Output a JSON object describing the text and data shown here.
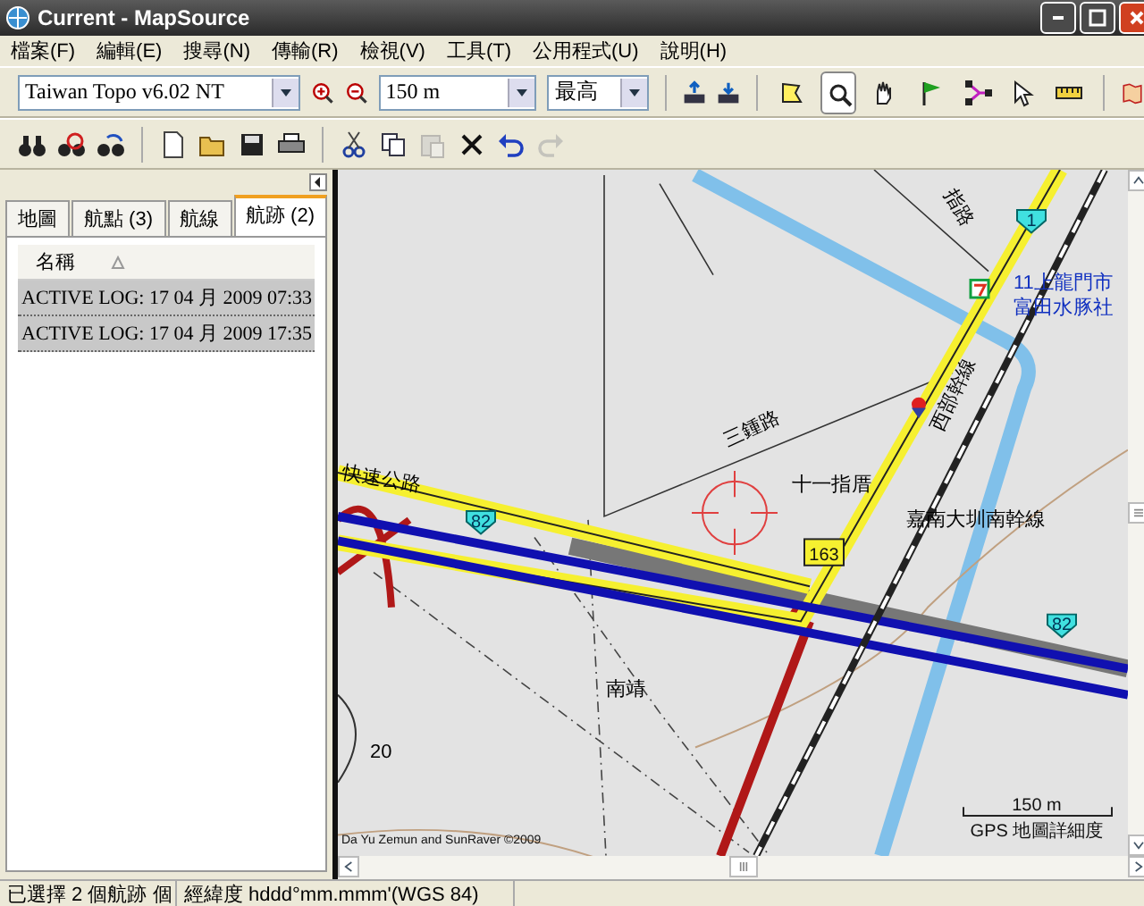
{
  "window": {
    "title": "Current - MapSource"
  },
  "menu": [
    "檔案(F)",
    "編輯(E)",
    "搜尋(N)",
    "傳輸(R)",
    "檢視(V)",
    "工具(T)",
    "公用程式(U)",
    "說明(H)"
  ],
  "toolbar": {
    "map_product": "Taiwan Topo v6.02 NT",
    "zoom_scale": "150 m",
    "detail": "最高",
    "tools": [
      {
        "selected": false
      },
      {
        "selected": true
      },
      {
        "selected": false
      },
      {
        "selected": false
      },
      {
        "selected": false
      },
      {
        "selected": false
      },
      {
        "selected": false
      }
    ]
  },
  "tabs": [
    {
      "label": "地圖",
      "selected": false
    },
    {
      "label": "航點 (3)",
      "selected": false
    },
    {
      "label": "航線",
      "selected": false
    },
    {
      "label": "航跡 (2)",
      "selected": true
    }
  ],
  "list": {
    "column": "名稱",
    "rows": [
      {
        "name": "ACTIVE LOG: 17 04 月 2009 07:33",
        "selected": true
      },
      {
        "name": "ACTIVE LOG: 17 04 月 2009 17:35",
        "selected": true
      }
    ]
  },
  "map": {
    "labels": [
      "指路",
      "11上龍門市",
      "富田水豚社",
      "三鍾路",
      "西部幹線",
      "十一指厝",
      "嘉南大圳南幹線",
      "快速公路",
      "南靖",
      "20"
    ],
    "shields": [
      "1",
      "82",
      "82",
      "163"
    ],
    "scale": "150 m",
    "detail_label": "GPS 地圖詳細度",
    "copyright": "Da Yu Zemun and SunRaver ©2009"
  },
  "status_bar": [
    "已選擇 2 個航跡 個",
    "經緯度 hddd°mm.mmm'(WGS 84)"
  ]
}
